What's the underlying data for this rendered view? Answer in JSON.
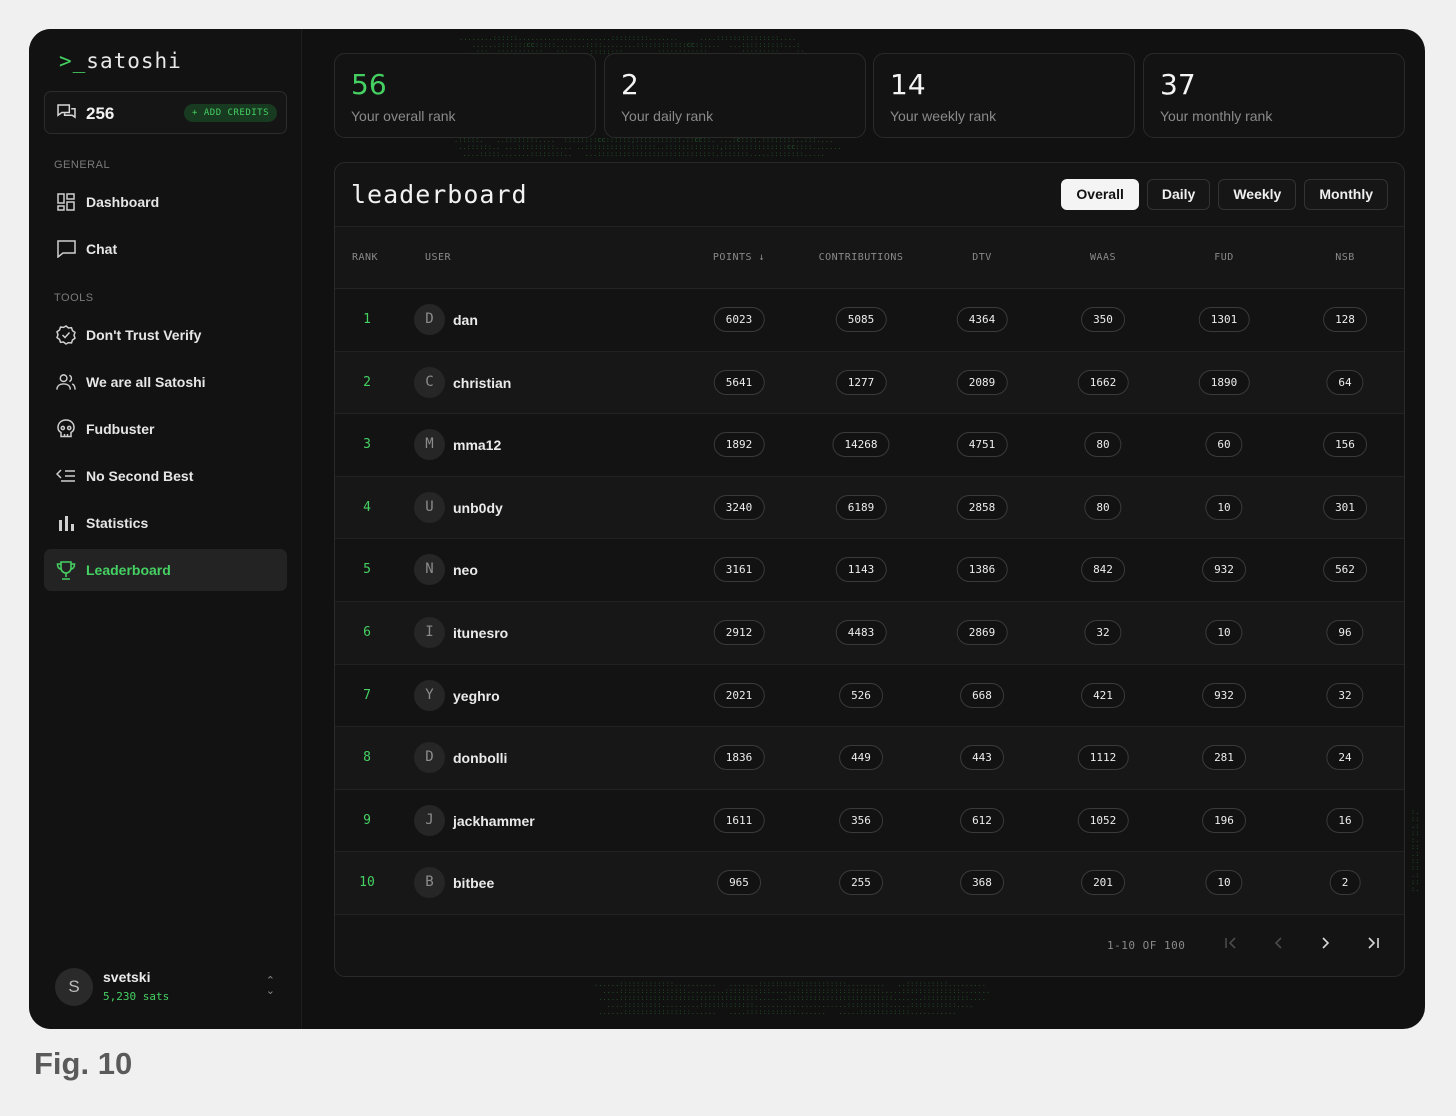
{
  "app": {
    "logo_prompt": ">_",
    "logo_name": "satoshi"
  },
  "credits": {
    "count": "256",
    "add_label": "+ ADD CREDITS",
    "icon": "chat-bubbles-icon"
  },
  "sidebar": {
    "general_label": "GENERAL",
    "tools_label": "TOOLS",
    "general_items": [
      {
        "label": "Dashboard",
        "icon": "dashboard-grid-icon"
      },
      {
        "label": "Chat",
        "icon": "chat-bubble-icon"
      }
    ],
    "tool_items": [
      {
        "label": "Don't Trust Verify",
        "icon": "verify-badge-icon"
      },
      {
        "label": "We are all Satoshi",
        "icon": "users-icon"
      },
      {
        "label": "Fudbuster",
        "icon": "skull-icon"
      },
      {
        "label": "No Second Best",
        "icon": "list-check-icon"
      },
      {
        "label": "Statistics",
        "icon": "bar-chart-icon"
      },
      {
        "label": "Leaderboard",
        "icon": "trophy-icon",
        "active": true
      }
    ],
    "user": {
      "initial": "S",
      "name": "svetski",
      "sats": "5,230 sats"
    }
  },
  "stats": [
    {
      "value": "56",
      "caption": "Your overall rank",
      "accent": true
    },
    {
      "value": "2",
      "caption": "Your daily rank"
    },
    {
      "value": "14",
      "caption": "Your weekly rank"
    },
    {
      "value": "37",
      "caption": "Your monthly rank"
    }
  ],
  "leaderboard": {
    "title": "leaderboard",
    "tabs": [
      "Overall",
      "Daily",
      "Weekly",
      "Monthly"
    ],
    "active_tab": "Overall",
    "columns": [
      "RANK",
      "USER",
      "POINTS ↓",
      "CONTRIBUTIONS",
      "DTV",
      "WAAS",
      "FUD",
      "NSB"
    ],
    "rows": [
      {
        "rank": "1",
        "initial": "D",
        "user": "dan",
        "points": "6023",
        "contributions": "5085",
        "dtv": "4364",
        "waas": "350",
        "fud": "1301",
        "nsb": "128"
      },
      {
        "rank": "2",
        "initial": "C",
        "user": "christian",
        "points": "5641",
        "contributions": "1277",
        "dtv": "2089",
        "waas": "1662",
        "fud": "1890",
        "nsb": "64"
      },
      {
        "rank": "3",
        "initial": "M",
        "user": "mma12",
        "points": "1892",
        "contributions": "14268",
        "dtv": "4751",
        "waas": "80",
        "fud": "60",
        "nsb": "156"
      },
      {
        "rank": "4",
        "initial": "U",
        "user": "unb0dy",
        "points": "3240",
        "contributions": "6189",
        "dtv": "2858",
        "waas": "80",
        "fud": "10",
        "nsb": "301"
      },
      {
        "rank": "5",
        "initial": "N",
        "user": "neo",
        "points": "3161",
        "contributions": "1143",
        "dtv": "1386",
        "waas": "842",
        "fud": "932",
        "nsb": "562"
      },
      {
        "rank": "6",
        "initial": "I",
        "user": "itunesro",
        "points": "2912",
        "contributions": "4483",
        "dtv": "2869",
        "waas": "32",
        "fud": "10",
        "nsb": "96"
      },
      {
        "rank": "7",
        "initial": "Y",
        "user": "yeghro",
        "points": "2021",
        "contributions": "526",
        "dtv": "668",
        "waas": "421",
        "fud": "932",
        "nsb": "32"
      },
      {
        "rank": "8",
        "initial": "D",
        "user": "donbolli",
        "points": "1836",
        "contributions": "449",
        "dtv": "443",
        "waas": "1112",
        "fud": "281",
        "nsb": "24"
      },
      {
        "rank": "9",
        "initial": "J",
        "user": "jackhammer",
        "points": "1611",
        "contributions": "356",
        "dtv": "612",
        "waas": "1052",
        "fud": "196",
        "nsb": "16"
      },
      {
        "rank": "10",
        "initial": "B",
        "user": "bitbee",
        "points": "965",
        "contributions": "255",
        "dtv": "368",
        "waas": "201",
        "fud": "10",
        "nsb": "2"
      }
    ],
    "pagination": {
      "info": "1-10 OF 100"
    }
  },
  "caption": "Fig. 10",
  "colors": {
    "accent": "#45d062",
    "background": "#111111",
    "panel": "#141414"
  }
}
